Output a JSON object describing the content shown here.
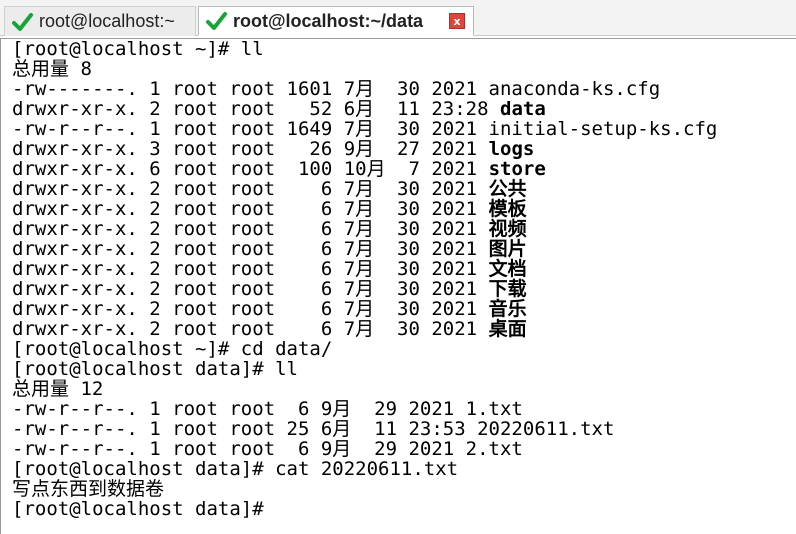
{
  "tabs": [
    {
      "label": "root@localhost:~",
      "active": false
    },
    {
      "label": "root@localhost:~/data",
      "active": true,
      "close_label": "x"
    }
  ],
  "colors": {
    "check_icon": "#1aa33a",
    "close_button": "#e0443b"
  },
  "terminal": {
    "lines": [
      [
        {
          "t": "[root@localhost ~]# ll"
        }
      ],
      [
        {
          "t": "总用量 8"
        }
      ],
      [
        {
          "t": "-rw-------. 1 root root 1601 7月  30 2021 anaconda-ks.cfg"
        }
      ],
      [
        {
          "t": "drwxr-xr-x. 2 root root   52 6月  11 23:28 "
        },
        {
          "t": "data",
          "b": true
        }
      ],
      [
        {
          "t": "-rw-r--r--. 1 root root 1649 7月  30 2021 initial-setup-ks.cfg"
        }
      ],
      [
        {
          "t": "drwxr-xr-x. 3 root root   26 9月  27 2021 "
        },
        {
          "t": "logs",
          "b": true
        }
      ],
      [
        {
          "t": "drwxr-xr-x. 6 root root  100 10月  7 2021 "
        },
        {
          "t": "store",
          "b": true
        }
      ],
      [
        {
          "t": "drwxr-xr-x. 2 root root    6 7月  30 2021 "
        },
        {
          "t": "公共",
          "b": true
        }
      ],
      [
        {
          "t": "drwxr-xr-x. 2 root root    6 7月  30 2021 "
        },
        {
          "t": "模板",
          "b": true
        }
      ],
      [
        {
          "t": "drwxr-xr-x. 2 root root    6 7月  30 2021 "
        },
        {
          "t": "视频",
          "b": true
        }
      ],
      [
        {
          "t": "drwxr-xr-x. 2 root root    6 7月  30 2021 "
        },
        {
          "t": "图片",
          "b": true
        }
      ],
      [
        {
          "t": "drwxr-xr-x. 2 root root    6 7月  30 2021 "
        },
        {
          "t": "文档",
          "b": true
        }
      ],
      [
        {
          "t": "drwxr-xr-x. 2 root root    6 7月  30 2021 "
        },
        {
          "t": "下载",
          "b": true
        }
      ],
      [
        {
          "t": "drwxr-xr-x. 2 root root    6 7月  30 2021 "
        },
        {
          "t": "音乐",
          "b": true
        }
      ],
      [
        {
          "t": "drwxr-xr-x. 2 root root    6 7月  30 2021 "
        },
        {
          "t": "桌面",
          "b": true
        }
      ],
      [
        {
          "t": "[root@localhost ~]# cd data/"
        }
      ],
      [
        {
          "t": "[root@localhost data]# ll"
        }
      ],
      [
        {
          "t": "总用量 12"
        }
      ],
      [
        {
          "t": "-rw-r--r--. 1 root root  6 9月  29 2021 1.txt"
        }
      ],
      [
        {
          "t": "-rw-r--r--. 1 root root 25 6月  11 23:53 20220611.txt"
        }
      ],
      [
        {
          "t": "-rw-r--r--. 1 root root  6 9月  29 2021 2.txt"
        }
      ],
      [
        {
          "t": "[root@localhost data]# cat 20220611.txt"
        }
      ],
      [
        {
          "t": "写点东西到数据卷",
          "serif": true
        }
      ],
      [
        {
          "t": "[root@localhost data]#"
        }
      ]
    ]
  }
}
